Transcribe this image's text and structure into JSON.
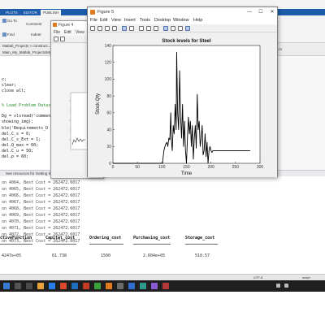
{
  "matlab": {
    "tabs": [
      "PLOTS",
      "EDITOR",
      "PUBLISH"
    ],
    "ribbon": {
      "goto_label": "Go To",
      "find_label": "Find",
      "comment_label": "Comment",
      "indent_label": "Indent"
    },
    "path": {
      "crumbs": "Matlab_Projects > construct...",
      "tab_left": "Main_My_Matlab_Projects\\My_Matlab_Projects.m",
      "tab1": "Preview",
      "tab2": "Model",
      "tab_right": "Mass_Connect.m"
    },
    "editor_lines": [
      "c;",
      "clear;",
      "close all;",
      "% Load Problem Datas",
      "Dg = xlsread('comment_",
      "showing_img);",
      "ble('Requirements_D",
      "del.C_s = 6;",
      "del.C_s_Ext = 1;",
      "del.Q_max = 60;",
      "del.C_u = 50;",
      "del.p = 60;"
    ],
    "cmd_header": "Command Window",
    "cmd_hint": "See resources for Getting Started.",
    "cmd_lines": [
      "on 4064, Best Cost = 262472.6017",
      "on 4065, Best Cost = 262472.6017",
      "on 4066, Best Cost = 262472.6017",
      "on 4067, Best Cost = 262472.6017",
      "on 4068, Best Cost = 262472.6017",
      "on 4069, Best Cost = 262472.6017",
      "on 4070, Best Cost = 262472.6017",
      "on 4071, Best Cost = 262472.6017",
      "on 4072, Best Cost = 262472.6017",
      "on 4073, Best Cost = 262472.6017"
    ],
    "table": {
      "headers": [
        "ctiveFunction",
        "Capital_cost",
        "Ordering_cost",
        "Purchasing_cost",
        "Storage_cost"
      ],
      "values": [
        "4247e+05",
        "61.738",
        "1500",
        "2.604e+05",
        "510.57"
      ]
    },
    "status": {
      "encoding": "UTF-8",
      "script": "script"
    }
  },
  "figure4": {
    "title": "Figure 4",
    "menu": [
      "File",
      "Edit",
      "View"
    ]
  },
  "figure5": {
    "title": "Figure 5",
    "window_buttons": {
      "min": "—",
      "max": "☐",
      "close": "✕"
    },
    "menu": [
      "File",
      "Edit",
      "View",
      "Insert",
      "Tools",
      "Desktop",
      "Window",
      "Help"
    ],
    "toolbar_icons": [
      "new-file-icon",
      "open-icon",
      "save-icon",
      "print-icon",
      "zoom-icon",
      "data-cursor-icon",
      "pan-icon",
      "rotate-icon",
      "brush-icon",
      "colorbar-icon",
      "legend-icon",
      "grid-icon",
      "axes-icon"
    ]
  },
  "chart_data": {
    "type": "line",
    "title": "Stock levels for Steel",
    "xlabel": "Time",
    "ylabel": "Stock Qty",
    "xlim": [
      0,
      300
    ],
    "ylim": [
      0,
      140
    ],
    "xticks": [
      0,
      50,
      100,
      150,
      200,
      250,
      300
    ],
    "yticks": [
      0,
      20,
      40,
      60,
      80,
      100,
      120,
      140
    ],
    "grid": false,
    "series": [
      {
        "color": "#000000",
        "x": [
          0,
          98,
          101,
          104,
          107,
          110,
          112,
          114,
          116,
          118,
          119,
          121,
          123,
          125,
          127,
          129,
          130,
          132,
          134,
          136,
          138,
          140,
          142,
          144,
          146,
          148,
          150,
          152,
          154,
          156,
          158,
          160,
          162,
          164,
          166,
          168,
          170,
          172,
          174,
          176,
          178,
          180,
          182,
          184,
          186,
          188,
          190,
          192,
          194,
          196,
          198,
          200,
          202,
          204,
          206,
          280
        ],
        "y": [
          0,
          0,
          0,
          15,
          22,
          25,
          20,
          30,
          28,
          60,
          30,
          15,
          45,
          35,
          70,
          40,
          132,
          60,
          40,
          110,
          55,
          30,
          70,
          20,
          50,
          15,
          0,
          30,
          55,
          35,
          50,
          20,
          45,
          5,
          30,
          45,
          18,
          82,
          40,
          50,
          20,
          30,
          45,
          10,
          15,
          35,
          8,
          25,
          0,
          15,
          20,
          15,
          13,
          15,
          15,
          15
        ]
      }
    ]
  }
}
